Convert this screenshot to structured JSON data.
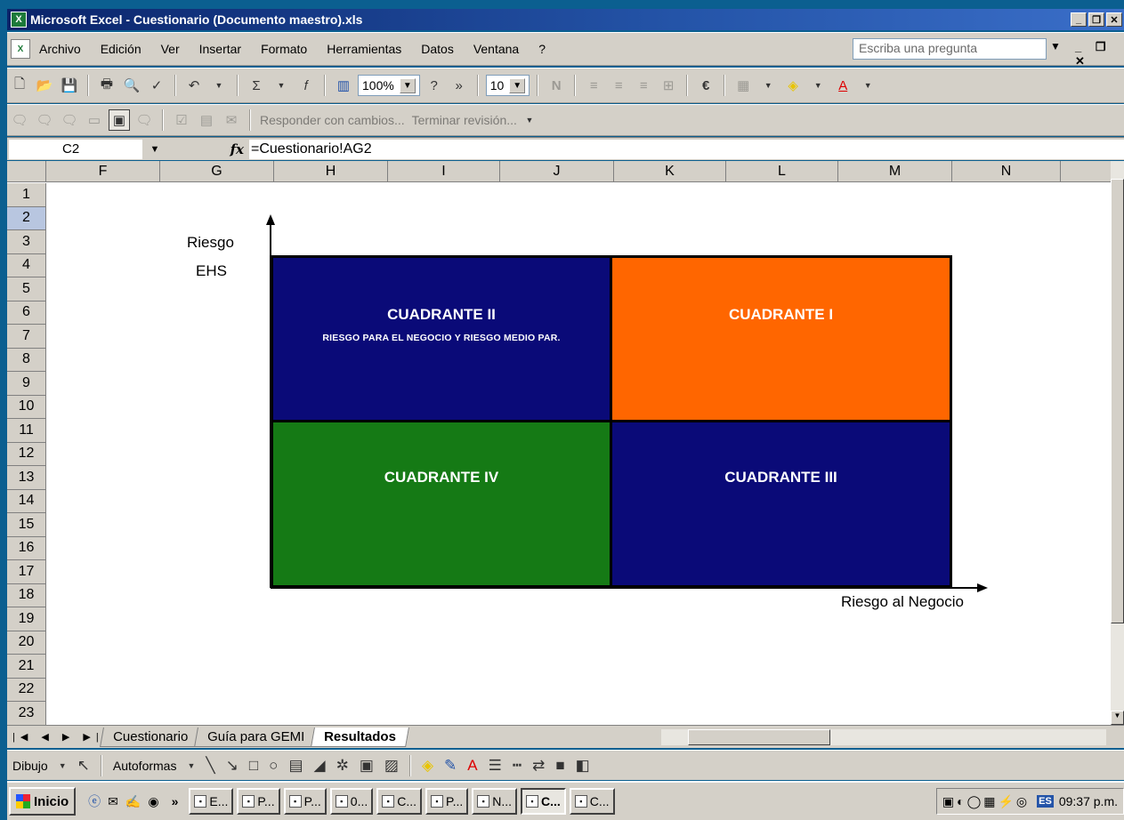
{
  "window": {
    "title": "Microsoft Excel - Cuestionario (Documento maestro).xls",
    "app_icon": "excel-icon",
    "controls": [
      "_",
      "□",
      "×"
    ]
  },
  "menu": {
    "items": [
      "Archivo",
      "Edición",
      "Ver",
      "Insertar",
      "Formato",
      "Herramientas",
      "Datos",
      "Ventana",
      "?"
    ],
    "ask_placeholder": "Escriba una pregunta"
  },
  "toolbar_standard": {
    "zoom": "100%",
    "font_size": "10",
    "currency_symbol": "€"
  },
  "toolbar_review": {
    "reply_label": "Responder con cambios...",
    "end_review_label": "Terminar revisión..."
  },
  "formula_bar": {
    "cell_reference": "C2",
    "fx_label": "fx",
    "formula": "=Cuestionario!AG2"
  },
  "grid": {
    "columns": [
      "F",
      "G",
      "H",
      "I",
      "J",
      "K",
      "L",
      "M",
      "N"
    ],
    "rows": [
      "1",
      "2",
      "3",
      "4",
      "5",
      "6",
      "7",
      "8",
      "9",
      "10",
      "11",
      "12",
      "13",
      "14",
      "15",
      "16",
      "17",
      "18",
      "19",
      "20",
      "21",
      "22",
      "23"
    ],
    "active_row": "2"
  },
  "quadrant_chart": {
    "y_axis_label_line1": "Riesgo",
    "y_axis_label_line2": "EHS",
    "x_axis_label": "Riesgo al Negocio",
    "q2_title": "CUADRANTE II",
    "q2_subtitle": "RIESGO PARA EL NEGOCIO Y RIESGO MEDIO PAR.",
    "q1_title": "CUADRANTE I",
    "q4_title": "CUADRANTE IV",
    "q3_title": "CUADRANTE III",
    "colors": {
      "q2": "#0a0a78",
      "q1": "#ff6600",
      "q4": "#157a15",
      "q3": "#0a0a78"
    }
  },
  "sheet_tabs": {
    "tabs": [
      "Cuestionario",
      "Guía para GEMI",
      "Resultados"
    ],
    "active": "Resultados"
  },
  "draw_toolbar": {
    "draw_label": "Dibujo",
    "autoshapes_label": "Autoformas"
  },
  "taskbar": {
    "start_label": "Inicio",
    "tasks": [
      "E...",
      "P...",
      "P...",
      "0...",
      "C...",
      "P...",
      "N...",
      "C...",
      "C..."
    ],
    "active_task_index": 7,
    "language": "ES",
    "clock": "09:37 p.m."
  }
}
